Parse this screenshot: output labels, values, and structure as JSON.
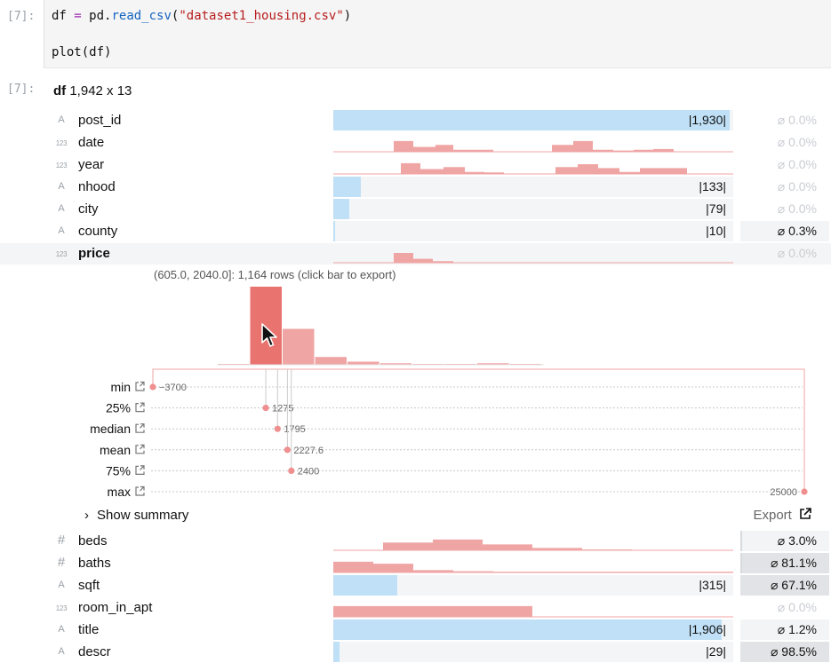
{
  "cell": {
    "input_prompt": "[7]:",
    "output_prompt": "[7]:",
    "code_line1": {
      "var": "df",
      "op": "=",
      "obj": "pd.",
      "fn": "read_csv",
      "open": "(",
      "str": "\"dataset1_housing.csv\"",
      "close": ")"
    },
    "code_line2": "plot(df)"
  },
  "dataframe": {
    "name": "df",
    "shape": "1,942 x 13"
  },
  "columns": [
    {
      "type": "A",
      "name": "post_id",
      "kind": "string",
      "unique": "|1,930|",
      "unique_frac": 1.0,
      "null": "⌀ 0.0%"
    },
    {
      "type": "123",
      "name": "date",
      "kind": "hist",
      "null": "⌀ 0.0%"
    },
    {
      "type": "123",
      "name": "year",
      "kind": "hist",
      "null": "⌀ 0.0%"
    },
    {
      "type": "A",
      "name": "nhood",
      "kind": "string",
      "unique": "|133|",
      "unique_frac": 0.069,
      "null": "⌀ 0.0%"
    },
    {
      "type": "A",
      "name": "city",
      "kind": "string",
      "unique": "|79|",
      "unique_frac": 0.041,
      "null": "⌀ 0.0%"
    },
    {
      "type": "A",
      "name": "county",
      "kind": "string",
      "unique": "|10|",
      "unique_frac": 0.005,
      "null": "⌀ 0.3%"
    },
    {
      "type": "123",
      "name": "price",
      "kind": "hist",
      "null": "⌀ 0.0%"
    },
    {
      "type": "#",
      "name": "beds",
      "kind": "hist",
      "null": "⌀ 3.0%"
    },
    {
      "type": "#",
      "name": "baths",
      "kind": "hist",
      "null": "⌀ 81.1%"
    },
    {
      "type": "A",
      "name": "sqft",
      "kind": "string",
      "unique": "|315|",
      "unique_frac": 0.162,
      "null": "⌀ 67.1%"
    },
    {
      "type": "123",
      "name": "room_in_apt",
      "kind": "hist",
      "null": "⌀ 0.0%"
    },
    {
      "type": "A",
      "name": "title",
      "kind": "string",
      "unique": "|1,906|",
      "unique_frac": 0.98,
      "null": "⌀ 1.2%"
    },
    {
      "type": "A",
      "name": "descr",
      "kind": "string",
      "unique": "|29|",
      "unique_frac": 0.015,
      "null": "⌀ 98.5%"
    }
  ],
  "price_detail": {
    "tooltip": "(605.0, 2040.0]: 1,164 rows (click bar to export)",
    "bins_rows": [
      0.01,
      1.0,
      0.46,
      0.1,
      0.04,
      0.02,
      0.01,
      0.01,
      0.02,
      0.01
    ],
    "stats": [
      {
        "label": "min",
        "value": "−3700",
        "num": -3700
      },
      {
        "label": "25%",
        "value": "1275",
        "num": 1275
      },
      {
        "label": "median",
        "value": "1795",
        "num": 1795
      },
      {
        "label": "mean",
        "value": "2227.6",
        "num": 2227.6
      },
      {
        "label": "75%",
        "value": "2400",
        "num": 2400
      },
      {
        "label": "max",
        "value": "25000",
        "num": 25000
      }
    ],
    "show_summary": "Show summary",
    "export": "Export"
  },
  "colors": {
    "bar": "#f0a5a5",
    "bar_active": "#e8736f",
    "string_bar": "#bfe0f6",
    "dot": "#ef8f8f"
  }
}
